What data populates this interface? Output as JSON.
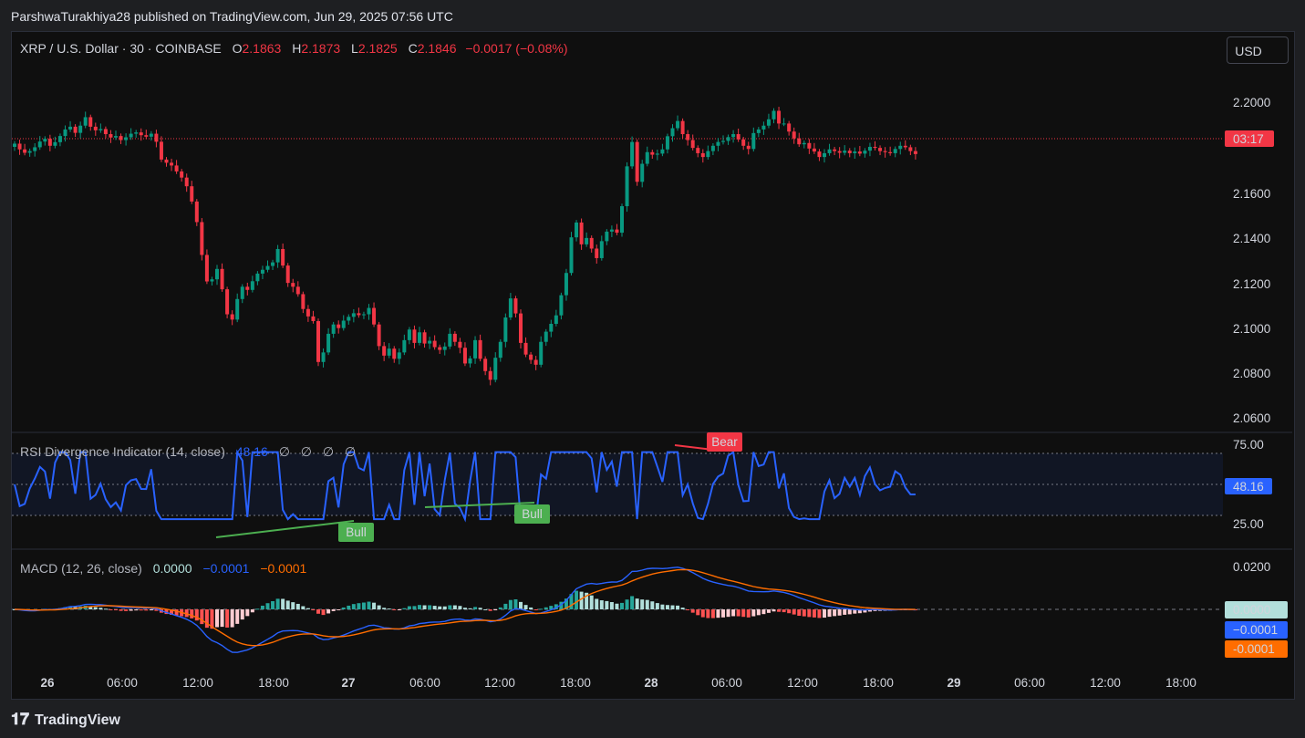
{
  "attribution": "ParshwaTurakhiya28 published on TradingView.com, Jun 29, 2025 07:56 UTC",
  "symbol": {
    "title": "XRP / U.S. Dollar · 30 · COINBASE",
    "open_label": "O",
    "open": "2.1863",
    "high_label": "H",
    "high": "2.1873",
    "low_label": "L",
    "low": "2.1825",
    "close_label": "C",
    "close": "2.1846",
    "change": "−0.0017 (−0.08%)"
  },
  "currency_button": "USD",
  "price_axis": [
    "2.2000",
    "2.1600",
    "2.1400",
    "2.1200",
    "2.1000",
    "2.0800",
    "2.0600"
  ],
  "countdown": "03:17",
  "rsi": {
    "label": "RSI Divergence Indicator (14, close)",
    "value": "48.16",
    "nulls": [
      "∅",
      "∅",
      "∅",
      "∅"
    ],
    "axis": [
      "75.00",
      "25.00"
    ],
    "badge": "48.16",
    "signals": [
      "Bull",
      "Bull",
      "Bear"
    ]
  },
  "macd": {
    "label": "MACD (12, 26, close)",
    "hist": "0.0000",
    "macd": "−0.0001",
    "signal": "−0.0001",
    "axis": [
      "0.0200"
    ],
    "badge_hist": "0.0000",
    "badge_macd": "−0.0001",
    "badge_signal": "-0.0001"
  },
  "time_axis": [
    "26",
    "06:00",
    "12:00",
    "18:00",
    "27",
    "06:00",
    "12:00",
    "18:00",
    "28",
    "06:00",
    "12:00",
    "18:00",
    "29",
    "06:00",
    "12:00",
    "18:00"
  ],
  "brand": "TradingView",
  "colors": {
    "up": "#089981",
    "down": "#f23645",
    "rsi": "#2962ff",
    "macd_signal": "#ff6d00",
    "bull": "#4caf50",
    "bear": "#f23645",
    "bg": "#0f0f0f"
  },
  "chart_data": {
    "type": "candlestick",
    "interval": "30",
    "ylim": [
      2.055,
      2.225
    ],
    "closes": [
      2.1895,
      2.1868,
      2.1852,
      2.186,
      2.1878,
      2.1905,
      2.1918,
      2.1885,
      2.1902,
      2.1931,
      2.1962,
      2.1975,
      2.1946,
      2.198,
      2.202,
      2.1975,
      2.1958,
      2.1964,
      2.194,
      2.1924,
      2.1931,
      2.1912,
      2.1925,
      2.1942,
      2.1948,
      2.1935,
      2.1928,
      2.1942,
      2.1904,
      2.182,
      2.1805,
      2.1792,
      2.1764,
      2.1735,
      2.1694,
      2.1622,
      2.1525,
      2.137,
      2.1245,
      2.1255,
      2.1304,
      2.1208,
      2.109,
      2.1065,
      2.1162,
      2.122,
      2.1205,
      2.1246,
      2.1282,
      2.13,
      2.1318,
      2.1335,
      2.1398,
      2.132,
      2.1238,
      2.122,
      2.1185,
      2.1115,
      2.108,
      2.1058,
      2.0865,
      2.091,
      2.0998,
      2.1042,
      2.1025,
      2.106,
      2.1078,
      2.1095,
      2.1086,
      2.109,
      2.112,
      2.1042,
      2.094,
      2.0895,
      2.0928,
      2.088,
      2.091,
      2.0968,
      2.1018,
      2.0955,
      2.1005,
      2.0952,
      2.0965,
      2.0935,
      2.0922,
      2.0938,
      2.0998,
      2.096,
      2.0932,
      2.0858,
      2.0882,
      2.0968,
      2.088,
      2.0822,
      2.0781,
      2.0885,
      2.096,
      2.1075,
      2.1165,
      2.1094,
      2.0955,
      2.09,
      2.0875,
      2.0852,
      2.096,
      2.1008,
      2.1045,
      2.1085,
      2.118,
      2.1285,
      2.1453,
      2.1523,
      2.142,
      2.145,
      2.14,
      2.1355,
      2.1435,
      2.148,
      2.149,
      2.1475,
      2.16,
      2.1788,
      2.1903,
      2.1715,
      2.18,
      2.1855,
      2.1843,
      2.1848,
      2.1868,
      2.193,
      2.1968,
      2.2002,
      2.194,
      2.1912,
      2.1875,
      2.185,
      2.1832,
      2.186,
      2.1885,
      2.1903,
      2.1908,
      2.1926,
      2.194,
      2.1915,
      2.1885,
      2.187,
      2.1945,
      2.1962,
      2.198,
      2.201,
      2.205,
      2.199,
      2.199,
      2.1952,
      2.192,
      2.1892,
      2.1898,
      2.1872,
      2.1858,
      2.1832,
      2.185,
      2.1868,
      2.186,
      2.1852,
      2.1862,
      2.185,
      2.1858,
      2.1848,
      2.1862,
      2.188,
      2.1875,
      2.186,
      2.1855,
      2.185,
      2.187,
      2.1885,
      2.1878,
      2.186,
      2.1846
    ]
  }
}
